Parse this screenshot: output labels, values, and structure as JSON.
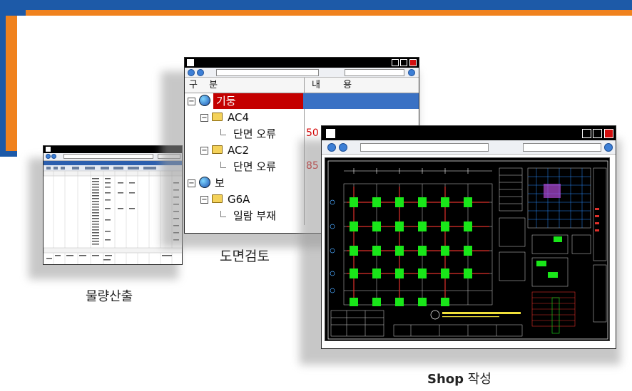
{
  "captions": {
    "quantity": "물량산출",
    "review": "도면검토",
    "shop_bold": "Shop",
    "shop_rest": " 작성"
  },
  "tree_window": {
    "header_col1": "구 분",
    "header_col2": "내 용",
    "rows": [
      {
        "label": "기둥",
        "value": ""
      },
      {
        "label": "AC4",
        "value": ""
      },
      {
        "label": "단면 오류",
        "value": "50"
      },
      {
        "label": "AC2",
        "value": ""
      },
      {
        "label": "단면 오류",
        "value": "85"
      },
      {
        "label": "보",
        "value": ""
      },
      {
        "label": "G6A",
        "value": ""
      },
      {
        "label": "일람 부재",
        "value": ""
      }
    ]
  },
  "colors": {
    "brand_blue": "#1d5aa8",
    "brand_orange": "#f0821e",
    "selected_red": "#c40000",
    "selected_blue": "#3a71c4",
    "cad_background": "#000000",
    "cad_green": "#19e619"
  },
  "icons": {
    "tree_root": "globe-icon",
    "tree_group": "folder-icon",
    "nav_back": "back-arrow-icon",
    "nav_forward": "forward-arrow-icon",
    "search": "search-icon",
    "go": "go-icon",
    "close": "close-icon"
  }
}
